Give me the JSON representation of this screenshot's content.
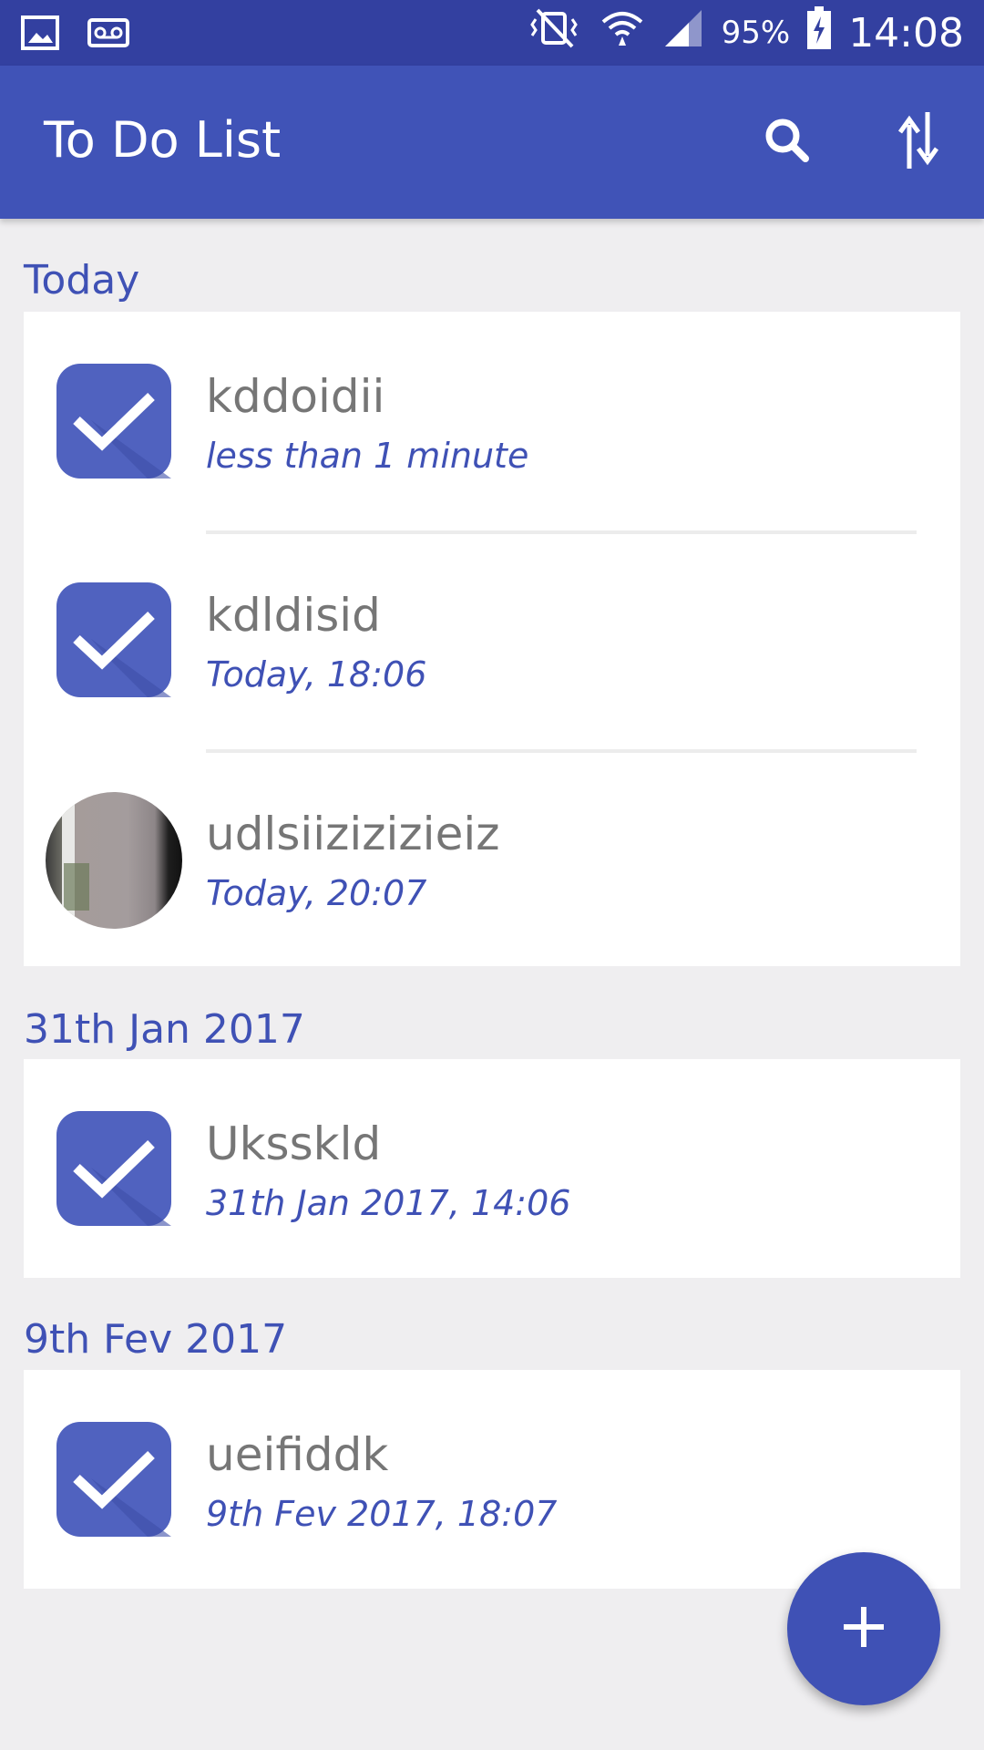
{
  "status_bar": {
    "icons": [
      "gallery-icon",
      "voicemail-icon",
      "vibrate-icon",
      "wifi-icon",
      "signal-icon",
      "battery-charging-icon"
    ],
    "battery": "95%",
    "time": "14:08"
  },
  "app_bar": {
    "title": "To Do List",
    "actions": [
      "search-icon",
      "sort-icon"
    ]
  },
  "colors": {
    "status_bar": "#3340a0",
    "primary": "#4053b7",
    "accent": "#3f51b5",
    "background": "#efeef0",
    "card": "#ffffff",
    "title_text": "#767676"
  },
  "sections": [
    {
      "header": "Today",
      "items": [
        {
          "title": "kddoidii",
          "time": "less than 1 minute",
          "icon": "check-icon"
        },
        {
          "title": "kdldisid",
          "time": "Today, 18:06",
          "icon": "check-icon"
        },
        {
          "title": "udlsiizizizieiz",
          "time": "Today, 20:07",
          "icon": "photo-avatar"
        }
      ]
    },
    {
      "header": "31th Jan 2017",
      "items": [
        {
          "title": "Uksskld",
          "time": "31th Jan 2017, 14:06",
          "icon": "check-icon"
        }
      ]
    },
    {
      "header": "9th Fev 2017",
      "items": [
        {
          "title": "ueifiddk",
          "time": "9th Fev 2017, 18:07",
          "icon": "check-icon"
        }
      ]
    }
  ],
  "fab": {
    "icon": "plus-icon"
  }
}
